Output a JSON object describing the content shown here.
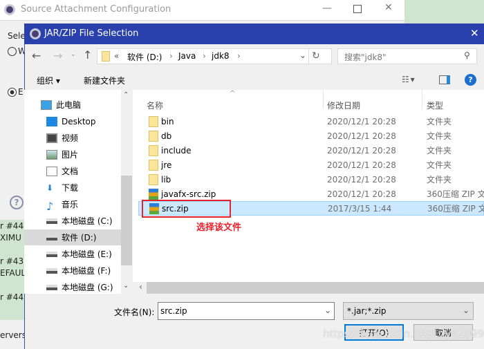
{
  "background_window": {
    "title": "Source Attachment Configuration",
    "left_fragments": [
      "Sele",
      "W",
      "E",
      "r #44",
      "XIMU",
      "r #43",
      "EFAUL",
      "r #44",
      "ervers"
    ]
  },
  "dialog": {
    "title": "JAR/ZIP File Selection",
    "address": {
      "path": [
        "软件 (D:)",
        "Java",
        "jdk8"
      ],
      "overflow": "«"
    },
    "search_placeholder": "搜索\"jdk8\"",
    "toolbar": {
      "organize": "组织 ▾",
      "new_folder": "新建文件夹"
    },
    "tree": [
      {
        "label": "此电脑",
        "icon": "computer-icon"
      },
      {
        "label": "Desktop",
        "icon": "desktop-icon"
      },
      {
        "label": "视频",
        "icon": "video-icon"
      },
      {
        "label": "图片",
        "icon": "picture-icon"
      },
      {
        "label": "文档",
        "icon": "document-icon"
      },
      {
        "label": "下载",
        "icon": "download-icon"
      },
      {
        "label": "音乐",
        "icon": "music-icon"
      },
      {
        "label": "本地磁盘 (C:)",
        "icon": "drive-icon"
      },
      {
        "label": "软件 (D:)",
        "icon": "drive-icon",
        "selected": true
      },
      {
        "label": "本地磁盘 (E:)",
        "icon": "drive-icon"
      },
      {
        "label": "本地磁盘 (F:)",
        "icon": "drive-icon"
      },
      {
        "label": "本地磁盘 (G:)",
        "icon": "drive-icon"
      }
    ],
    "columns": {
      "name": "名称",
      "date": "修改日期",
      "type": "类型"
    },
    "files": [
      {
        "name": "bin",
        "date": "2020/12/1 20:28",
        "type": "文件夹",
        "kind": "folder"
      },
      {
        "name": "db",
        "date": "2020/12/1 20:28",
        "type": "文件夹",
        "kind": "folder"
      },
      {
        "name": "include",
        "date": "2020/12/1 20:28",
        "type": "文件夹",
        "kind": "folder"
      },
      {
        "name": "jre",
        "date": "2020/12/1 20:28",
        "type": "文件夹",
        "kind": "folder"
      },
      {
        "name": "lib",
        "date": "2020/12/1 20:28",
        "type": "文件夹",
        "kind": "folder"
      },
      {
        "name": "javafx-src.zip",
        "date": "2020/12/1 20:28",
        "type": "360压缩 ZIP 文",
        "kind": "zip"
      },
      {
        "name": "src.zip",
        "date": "2017/3/15 1:44",
        "type": "360压缩 ZIP 文",
        "kind": "zip",
        "selected": true
      }
    ],
    "annotation": "选择该文件",
    "filename_label": "文件名(N):",
    "filename_value": "src.zip",
    "filter": "*.jar;*.zip",
    "open": "打开(O)",
    "cancel": "取消"
  },
  "watermark": "https://blog.csdn.net/Lzy410992",
  "colors": {
    "titlebar": "#2a41ad",
    "selection": "#cce8ff",
    "annotation": "#e8202a"
  }
}
